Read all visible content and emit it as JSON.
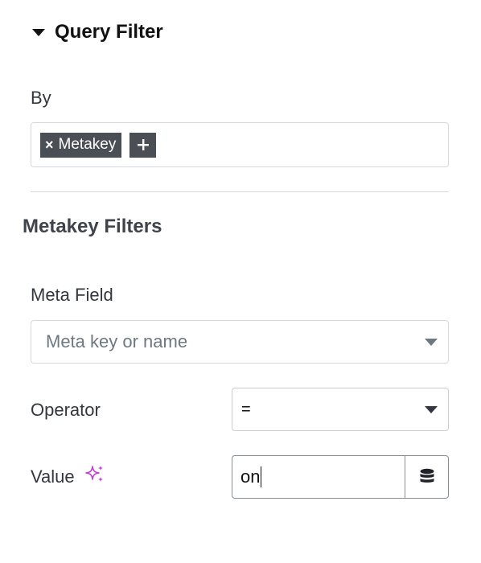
{
  "section": {
    "title": "Query Filter"
  },
  "by": {
    "label": "By",
    "tags": [
      {
        "remove": "×",
        "label": "Metakey"
      }
    ],
    "add_symbol": "+"
  },
  "metakey_filters": {
    "title": "Metakey Filters",
    "meta_field": {
      "label": "Meta Field",
      "placeholder": "Meta key or name"
    },
    "operator": {
      "label": "Operator",
      "value": "="
    },
    "value": {
      "label": "Value",
      "current": "on"
    }
  },
  "icons": {
    "section_toggle": "caret-down-icon",
    "ai": "sparkle-icon",
    "dynamic": "database-icon",
    "dropdown": "caret-down-icon"
  },
  "colors": {
    "tag_bg": "#4a4e55",
    "sparkle": "#c23bd4",
    "border": "#d5d8dc",
    "text": "#333740"
  }
}
